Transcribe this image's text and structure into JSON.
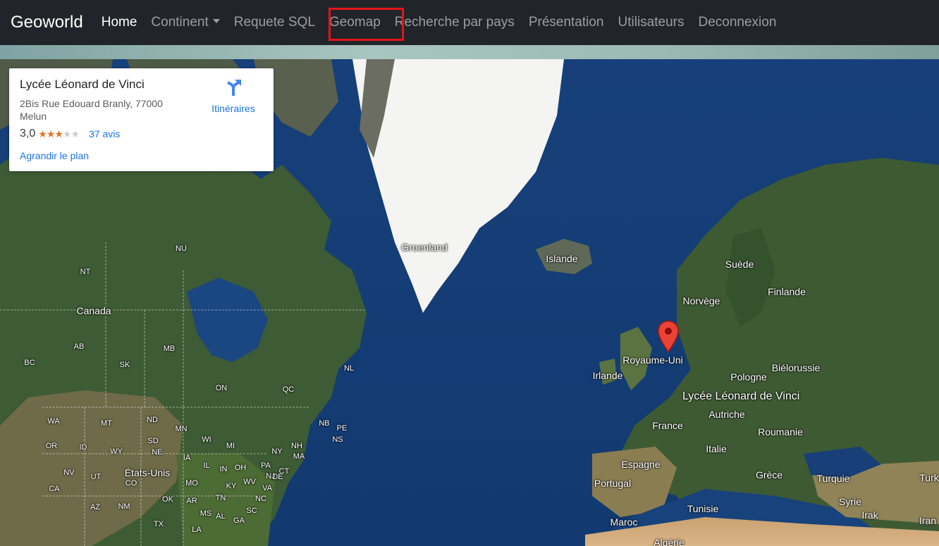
{
  "navbar": {
    "brand": "Geoworld",
    "items": [
      {
        "label": "Home",
        "active": true
      },
      {
        "label": "Continent",
        "dropdown": true
      },
      {
        "label": "Requete SQL"
      },
      {
        "label": "Geomap",
        "highlighted": true
      },
      {
        "label": "Recherche par pays"
      },
      {
        "label": "Présentation"
      },
      {
        "label": "Utilisateurs"
      },
      {
        "label": "Deconnexion"
      }
    ]
  },
  "info_card": {
    "title": "Lycée Léonard de Vinci",
    "address": "2Bis Rue Edouard Branly, 77000 Melun",
    "rating": "3,0",
    "rating_stars": 3,
    "reviews": "37 avis",
    "directions_label": "Itinéraires",
    "enlarge_label": "Agrandir le plan",
    "directions_icon": "directions-icon"
  },
  "map": {
    "marker_label": "Lycée Léonard de Vinci",
    "marker_icon": "map-pin-icon",
    "countries": [
      "Groenland",
      "Islande",
      "Canada",
      "États-Unis",
      "Suède",
      "Finlande",
      "Norvège",
      "Royaume-Uni",
      "Irlande",
      "Pologne",
      "Biélorussie",
      "France",
      "Autriche",
      "Roumanie",
      "Italie",
      "Espagne",
      "Portugal",
      "Grèce",
      "Turquie",
      "Turk",
      "Tunisie",
      "Syrie",
      "Irak",
      "Iran",
      "Maroc",
      "Algérie"
    ],
    "states": [
      "NU",
      "NT",
      "AB",
      "MB",
      "BC",
      "SK",
      "ON",
      "QC",
      "NL",
      "NB",
      "PE",
      "NS",
      "WA",
      "MT",
      "ND",
      "MN",
      "OR",
      "ID",
      "SD",
      "WI",
      "MI",
      "NY",
      "NH",
      "MA",
      "WY",
      "NE",
      "IA",
      "NV",
      "UT",
      "IL",
      "IN",
      "OH",
      "PA",
      "NJ",
      "CT",
      "CA",
      "CO",
      "MO",
      "KY",
      "WV",
      "VA",
      "DE",
      "AZ",
      "NM",
      "OK",
      "AR",
      "TN",
      "NC",
      "MS",
      "AL",
      "GA",
      "SC",
      "TX",
      "LA"
    ]
  },
  "colors": {
    "navbar_bg": "#212529",
    "highlight": "#e3141c",
    "link": "#1a73e8",
    "star": "#e7711b",
    "pin": "#ea4335"
  }
}
